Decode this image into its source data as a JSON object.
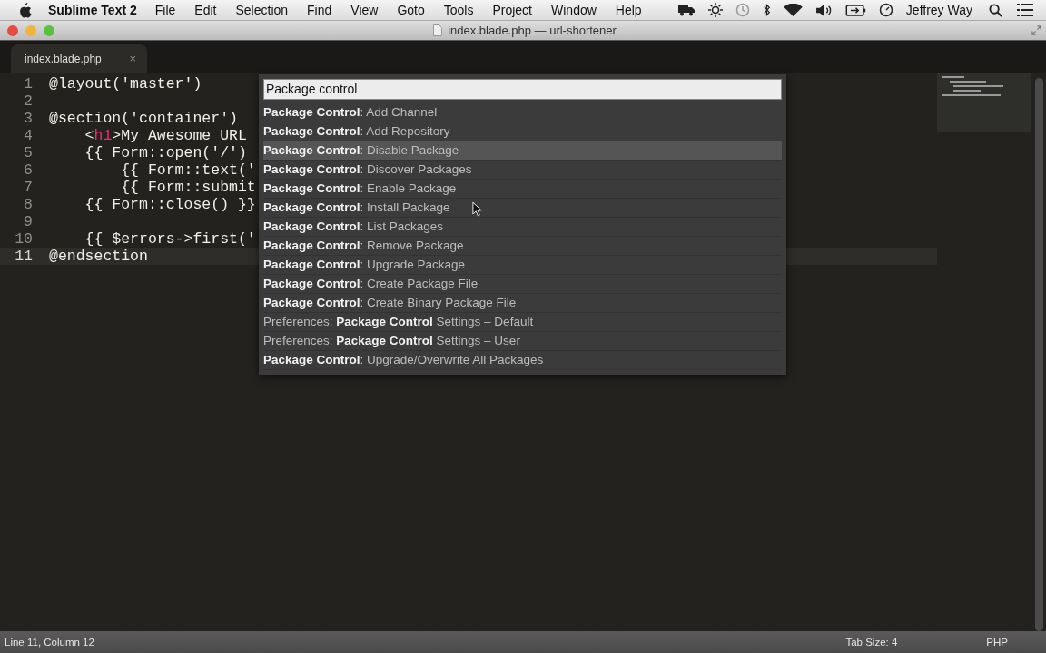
{
  "menu_bar": {
    "app_name": "Sublime Text 2",
    "menus": [
      "File",
      "Edit",
      "Selection",
      "Find",
      "View",
      "Goto",
      "Tools",
      "Project",
      "Window",
      "Help"
    ],
    "user": "Jeffrey Way"
  },
  "window": {
    "title": "index.blade.php — url-shortener"
  },
  "tabs": [
    {
      "label": "index.blade.php",
      "close": "×",
      "selected": true
    }
  ],
  "editor": {
    "lines": [
      {
        "number": "1",
        "current": false,
        "segments": [
          {
            "text": "@layout('master')",
            "kind": "plain"
          }
        ]
      },
      {
        "number": "2",
        "current": false
      },
      {
        "number": "3",
        "current": false,
        "segments": [
          {
            "text": "@section('container')",
            "kind": "plain"
          }
        ]
      },
      {
        "number": "4",
        "current": false,
        "segments": [
          {
            "text": "    <",
            "kind": "plain"
          },
          {
            "text": "h1",
            "kind": "tag"
          },
          {
            "text": ">My Awesome URL",
            "kind": "plain"
          }
        ]
      },
      {
        "number": "5",
        "current": false,
        "segments": [
          {
            "text": "    {{ Form::open('/')",
            "kind": "plain"
          }
        ]
      },
      {
        "number": "6",
        "current": false,
        "segments": [
          {
            "text": "        {{ Form::text('",
            "kind": "plain"
          }
        ]
      },
      {
        "number": "7",
        "current": false,
        "segments": [
          {
            "text": "        {{ Form::submit",
            "kind": "plain"
          }
        ]
      },
      {
        "number": "8",
        "current": false,
        "segments": [
          {
            "text": "    {{ Form::close() }}",
            "kind": "plain"
          }
        ]
      },
      {
        "number": "9",
        "current": false
      },
      {
        "number": "10",
        "current": false,
        "segments": [
          {
            "text": "    {{ $errors->first('",
            "kind": "plain"
          }
        ]
      },
      {
        "number": "11",
        "current": true,
        "segments": [
          {
            "text": "@endsection",
            "kind": "plain"
          }
        ]
      }
    ]
  },
  "command_palette": {
    "value": "Package control",
    "items": [
      {
        "label": "**Package Control**: Add Channel",
        "selected": false
      },
      {
        "label": "**Package Control**: Add Repository",
        "selected": false
      },
      {
        "label": "**Package Control**: Disable Package",
        "selected": true
      },
      {
        "label": "**Package Control**: Discover Packages",
        "selected": false
      },
      {
        "label": "**Package Control**: Enable Package",
        "selected": false
      },
      {
        "label": "**Package Control**: Install Package",
        "selected": false
      },
      {
        "label": "**Package Control**: List Packages",
        "selected": false
      },
      {
        "label": "**Package Control**: Remove Package",
        "selected": false
      },
      {
        "label": "**Package Control**: Upgrade Package",
        "selected": false
      },
      {
        "label": "**Package Control**: Create Package File",
        "selected": false
      },
      {
        "label": "**Package Control**: Create Binary Package File",
        "selected": false
      },
      {
        "label": "Preferences: **Package Control** Settings – Default",
        "selected": false
      },
      {
        "label": "Preferences: **Package Control** Settings – User",
        "selected": false
      },
      {
        "label": "**Package Control**: Upgrade/Overwrite All Packages",
        "selected": false
      }
    ]
  },
  "status_bar": {
    "position": "Line 11, Column 12",
    "tab_size": "Tab Size: 4",
    "syntax": "PHP"
  }
}
